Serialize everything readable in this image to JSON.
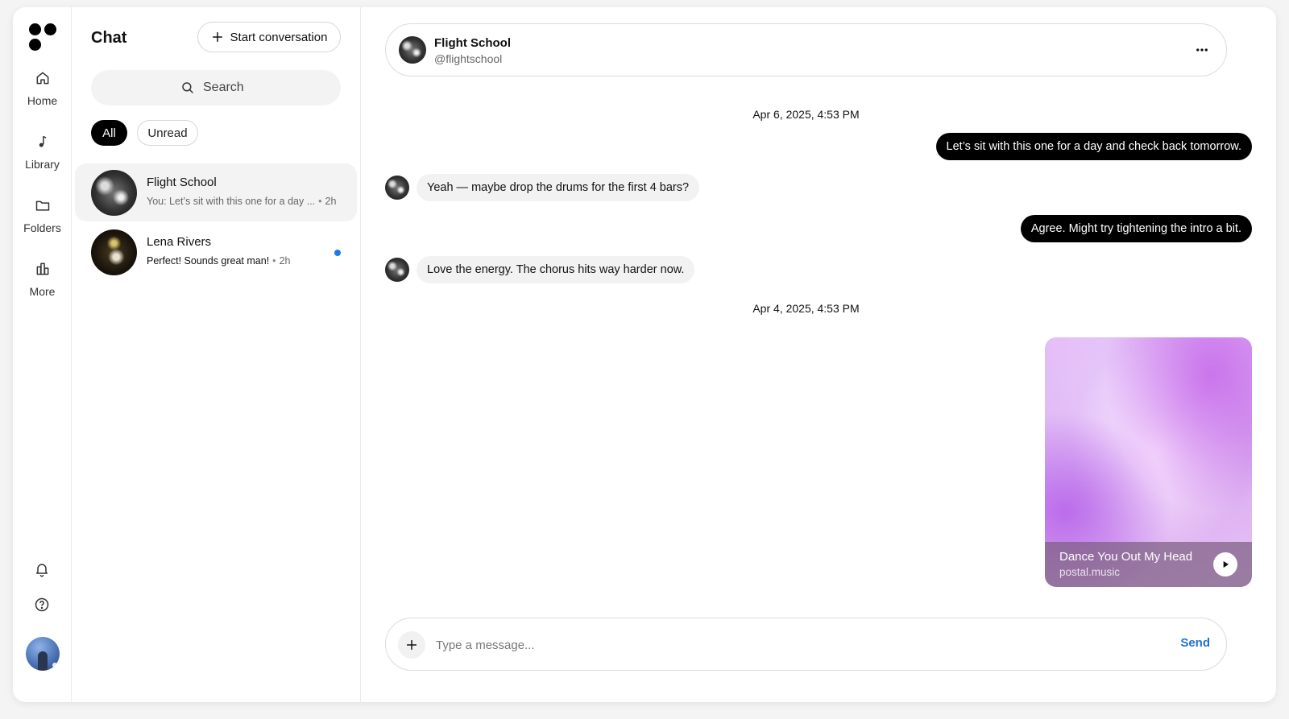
{
  "rail": {
    "nav": [
      {
        "label": "Home",
        "icon": "home-icon"
      },
      {
        "label": "Library",
        "icon": "music-note-icon"
      },
      {
        "label": "Folders",
        "icon": "folder-icon"
      },
      {
        "label": "More",
        "icon": "more-grid-icon"
      }
    ],
    "bottom_icons": [
      "bell-icon",
      "help-icon"
    ]
  },
  "list": {
    "title": "Chat",
    "start_label": "Start conversation",
    "search_placeholder": "Search",
    "filters": {
      "all": "All",
      "unread": "Unread"
    },
    "conversations": [
      {
        "name": "Flight School",
        "preview": "You: Let’s sit with this one for a day ...",
        "time": "2h",
        "active": true,
        "unread": false
      },
      {
        "name": "Lena Rivers",
        "preview": "Perfect! Sounds great man!",
        "time": "2h",
        "active": false,
        "unread": true
      }
    ]
  },
  "chat": {
    "name": "Flight School",
    "handle": "@flightschool",
    "timestamps": [
      "Apr 6, 2025, 4:53 PM",
      "Apr 4, 2025, 4:53 PM"
    ],
    "messages": [
      {
        "dir": "out",
        "text": "Let’s sit with this one for a day and check back tomorrow."
      },
      {
        "dir": "in",
        "text": "Yeah — maybe drop the drums for the first 4 bars?"
      },
      {
        "dir": "out",
        "text": "Agree. Might try tightening the intro a bit."
      },
      {
        "dir": "in",
        "text": "Love the energy. The chorus hits way harder now."
      }
    ],
    "card": {
      "title": "Dance You Out My Head",
      "source": "postal.music"
    },
    "composer": {
      "placeholder": "Type a message...",
      "send_label": "Send"
    }
  },
  "colors": {
    "accent": "#1f6fd6",
    "unread_dot": "#1f7ae0",
    "bubble_out": "#000000",
    "bubble_in": "#f2f2f2"
  }
}
